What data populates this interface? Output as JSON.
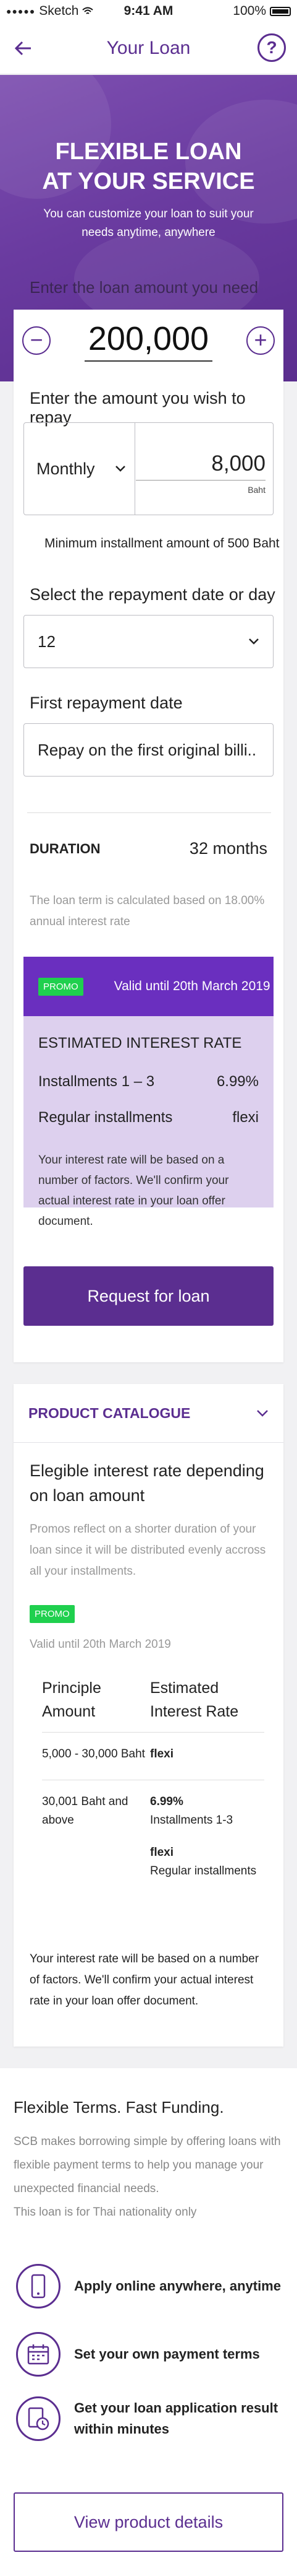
{
  "status_bar": {
    "carrier": "Sketch",
    "time": "9:41 AM",
    "battery": "100%"
  },
  "nav": {
    "title": "Your Loan",
    "help": "?"
  },
  "hero": {
    "headline_1": "FLEXIBLE LOAN",
    "headline_2": "AT YOUR SERVICE",
    "subtitle": "You can customize your loan to suit your needs anytime, anywhere",
    "enter_amount_label": "Enter the loan amount you need"
  },
  "amount": {
    "minus": "−",
    "value": "200,000",
    "plus": "+"
  },
  "repay": {
    "label": "Enter the amount you wish to repay",
    "frequency": "Monthly",
    "value": "8,000",
    "unit": "Baht",
    "minimum_note": "Minimum installment amount of 500 Baht"
  },
  "repayment_date": {
    "label": "Select the repayment date or day",
    "value": "12"
  },
  "first_repayment": {
    "label": "First repayment date",
    "value": "Repay on the first original billi.."
  },
  "duration": {
    "label": "DURATION",
    "value": "32 months",
    "note": "The loan term is calculated based on 18.00% annual interest rate"
  },
  "promo": {
    "badge": "PROMO",
    "until": "Valid until 20th March 2019",
    "title": "ESTIMATED INTEREST RATE",
    "rows": [
      {
        "label": "Installments 1 – 3",
        "value": "6.99%"
      },
      {
        "label": "Regular installments",
        "value": "flexi"
      }
    ],
    "description": "Your interest rate will be based on a number of factors. We'll confirm your actual interest rate in your loan offer document."
  },
  "cta": {
    "label": "Request for loan"
  },
  "catalogue": {
    "title": "PRODUCT CATALOGUE",
    "heading": "Elegible interest rate depending on loan amount",
    "description": "Promos reflect on a shorter duration of your loan since it will be distributed evenly accross all your installments.",
    "badge": "PROMO",
    "until": "Valid until 20th March 2019",
    "table": {
      "headers": [
        "Principle Amount",
        "Estimated Interest Rate"
      ],
      "rows": [
        {
          "amount": "5,000 - 30,000 Baht",
          "rate_1": "flexi",
          "rate_1_sub": "",
          "rate_2": "",
          "rate_2_sub": ""
        },
        {
          "amount": "30,001 Baht and above",
          "rate_1": "6.99%",
          "rate_1_sub": "Installments 1-3",
          "rate_2": "flexi",
          "rate_2_sub": "Regular installments"
        }
      ]
    },
    "footer": "Your interest rate will be based on a number of factors. We'll confirm your actual interest rate in your loan offer document."
  },
  "flexible": {
    "title": "Flexible Terms. Fast Funding.",
    "description_1": "SCB makes borrowing simple by offering loans with flexible payment terms to help you manage your unexpected financial needs.",
    "description_2": "This loan is for Thai nationality only",
    "features": [
      {
        "icon": "phone-icon",
        "text": "Apply online anywhere, anytime"
      },
      {
        "icon": "calendar-icon",
        "text": "Set your own payment terms"
      },
      {
        "icon": "clock-document-icon",
        "text": "Get your loan application result within minutes"
      }
    ],
    "button": "View product details"
  },
  "colors": {
    "brand": "#5b2e90",
    "promo_header": "#6a2fbf",
    "promo_bg": "#ddd0ee",
    "promo_badge": "#1fd04e"
  }
}
